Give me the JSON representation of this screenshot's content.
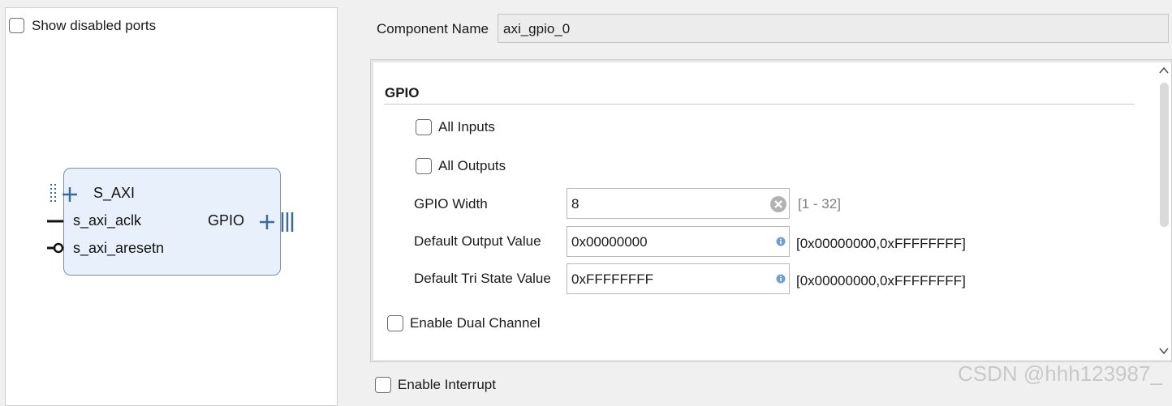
{
  "left_panel": {
    "show_disabled_ports_label": "Show disabled ports",
    "show_disabled_ports_checked": false,
    "ip_block": {
      "ports": {
        "s_axi": "S_AXI",
        "aclk": "s_axi_aclk",
        "aresetn": "s_axi_aresetn",
        "gpio": "GPIO"
      }
    }
  },
  "component": {
    "label": "Component Name",
    "value": "axi_gpio_0"
  },
  "gpio_section": {
    "title": "GPIO",
    "all_inputs": {
      "label": "All Inputs",
      "checked": false
    },
    "all_outputs": {
      "label": "All Outputs",
      "checked": false
    },
    "gpio_width": {
      "label": "GPIO Width",
      "value": "8",
      "range": "[1 - 32]"
    },
    "default_output_value": {
      "label": "Default Output Value",
      "value": "0x00000000",
      "range": "[0x00000000,0xFFFFFFFF]"
    },
    "default_tri_state_value": {
      "label": "Default Tri State Value",
      "value": "0xFFFFFFFF",
      "range": "[0x00000000,0xFFFFFFFF]"
    },
    "enable_dual_channel": {
      "label": "Enable Dual Channel",
      "checked": false
    }
  },
  "enable_interrupt": {
    "label": "Enable Interrupt",
    "checked": false
  },
  "watermark": "CSDN @hhh123987_",
  "colors": {
    "ip_block_fill": "#e8f1fb",
    "ip_block_border": "#7a8ea6",
    "port_blue": "#3c6a9c",
    "info_icon_blue": "#6e9fd3"
  }
}
